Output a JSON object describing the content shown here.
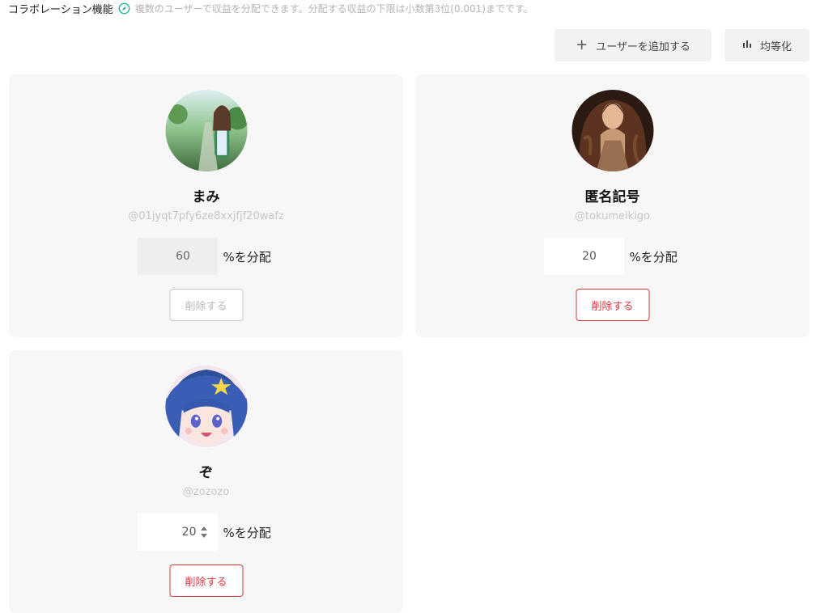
{
  "header": {
    "title": "コラボレーション機能",
    "description": "複数のユーザーで収益を分配できます。分配する収益の下限は小数第3位(0.001)までです。"
  },
  "toolbar": {
    "add_user_label": "ユーザーを追加する",
    "equalize_label": "均等化"
  },
  "users": [
    {
      "name": "まみ",
      "handle": "@01jyqt7pfy6ze8xxjfjf20wafz",
      "percent": "60",
      "percent_label": "%を分配",
      "delete_label": "削除する",
      "editable": false
    },
    {
      "name": "匿名記号",
      "handle": "@tokumeikigo",
      "percent": "20",
      "percent_label": "%を分配",
      "delete_label": "削除する",
      "editable": true
    },
    {
      "name": "ぞ",
      "handle": "@zozozo",
      "percent": "20",
      "percent_label": "%を分配",
      "delete_label": "削除する",
      "editable": true
    }
  ],
  "colors": {
    "accent_teal": "#23b3a0",
    "danger": "#d9363e",
    "card_bg": "#f7f7f7"
  }
}
